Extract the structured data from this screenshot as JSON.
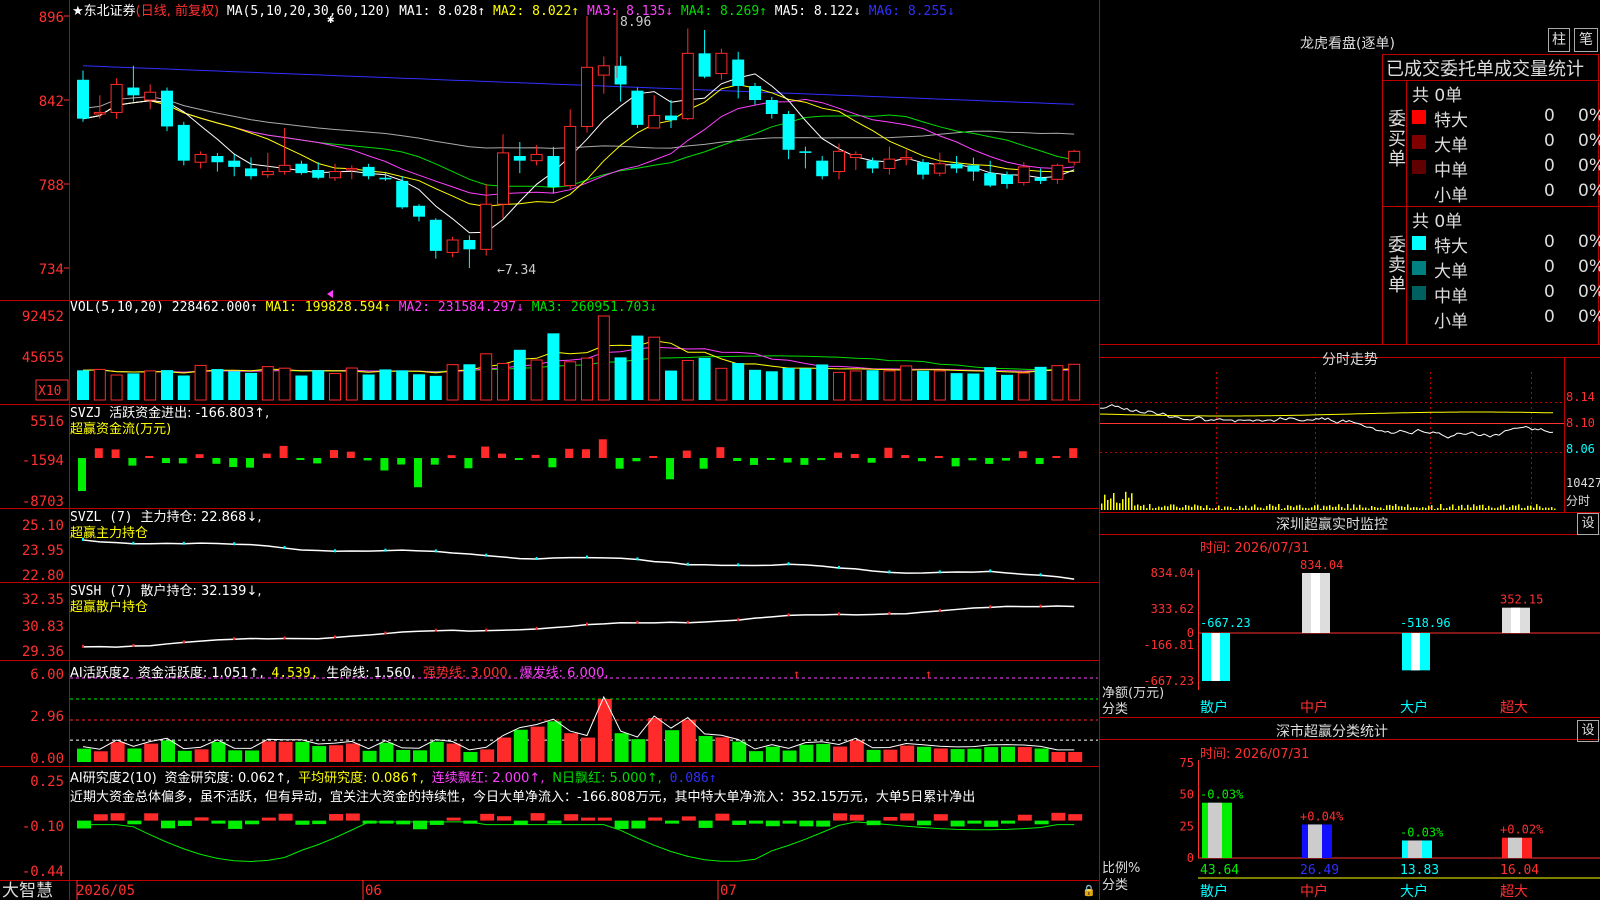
{
  "colors": {
    "up": "#ff2a2a",
    "down": "#00ffff",
    "green": "#00ee00",
    "ma1": "#ffffff",
    "ma2": "#ffff00",
    "ma3": "#ff40ff",
    "ma4": "#00dd00",
    "ma5": "#aaaaaa",
    "ma6": "#3030ff",
    "frame": "#c00000",
    "yellow": "#ffff00",
    "magenta": "#ff40ff"
  },
  "price": {
    "name": "★东北证券",
    "mode": "(日线, 前复权)",
    "ma_title": "MA(5,10,20,30,60,120)",
    "ma1": "MA1: 8.028↑",
    "ma2": "MA2: 8.022↑",
    "ma3": "MA3: 8.135↓",
    "ma4": "MA4: 8.269↑",
    "ma5": "MA5: 8.122↓",
    "ma6": "MA6: 8.255↓",
    "axis": [
      "896",
      "842",
      "788",
      "734"
    ],
    "hi_label": "8.96",
    "lo_label": "←7.34",
    "candles": [
      [
        8.55,
        8.3,
        8.61,
        8.28
      ],
      [
        8.33,
        8.34,
        8.45,
        8.3
      ],
      [
        8.34,
        8.52,
        8.56,
        8.3
      ],
      [
        8.5,
        8.45,
        8.64,
        8.41
      ],
      [
        8.42,
        8.47,
        8.52,
        8.36
      ],
      [
        8.48,
        8.25,
        8.5,
        8.22
      ],
      [
        8.26,
        8.03,
        8.28,
        8.0
      ],
      [
        8.02,
        8.07,
        8.09,
        7.98
      ],
      [
        8.06,
        8.02,
        8.08,
        7.96
      ],
      [
        8.03,
        7.99,
        8.07,
        7.93
      ],
      [
        7.98,
        7.93,
        8.05,
        7.91
      ],
      [
        7.94,
        7.96,
        8.08,
        7.92
      ],
      [
        7.96,
        8.0,
        8.24,
        7.94
      ],
      [
        8.01,
        7.95,
        8.03,
        7.94
      ],
      [
        7.97,
        7.92,
        8.02,
        7.91
      ],
      [
        7.92,
        7.96,
        8.01,
        7.9
      ],
      [
        7.97,
        7.98,
        8.0,
        7.91
      ],
      [
        7.99,
        7.93,
        8.01,
        7.91
      ],
      [
        7.92,
        7.91,
        7.95,
        7.9
      ],
      [
        7.9,
        7.73,
        7.93,
        7.72
      ],
      [
        7.74,
        7.67,
        7.75,
        7.64
      ],
      [
        7.65,
        7.45,
        7.66,
        7.4
      ],
      [
        7.44,
        7.52,
        7.54,
        7.41
      ],
      [
        7.52,
        7.46,
        7.55,
        7.34
      ],
      [
        7.46,
        7.75,
        7.88,
        7.42
      ],
      [
        7.75,
        8.08,
        8.2,
        7.66
      ],
      [
        8.06,
        8.03,
        8.15,
        7.95
      ],
      [
        8.03,
        8.07,
        8.13,
        8.0
      ],
      [
        8.06,
        7.86,
        8.12,
        7.82
      ],
      [
        7.87,
        8.25,
        8.36,
        7.85
      ],
      [
        8.25,
        8.63,
        8.96,
        8.21
      ],
      [
        8.58,
        8.64,
        8.7,
        8.46
      ],
      [
        8.64,
        8.52,
        8.7,
        8.41
      ],
      [
        8.48,
        8.26,
        8.5,
        8.24
      ],
      [
        8.24,
        8.32,
        8.45,
        8.25
      ],
      [
        8.32,
        8.29,
        8.42,
        8.24
      ],
      [
        8.3,
        8.72,
        8.88,
        8.29
      ],
      [
        8.72,
        8.57,
        8.87,
        8.56
      ],
      [
        8.59,
        8.72,
        8.75,
        8.55
      ],
      [
        8.68,
        8.51,
        8.73,
        8.43
      ],
      [
        8.51,
        8.42,
        8.53,
        8.39
      ],
      [
        8.42,
        8.33,
        8.44,
        8.3
      ],
      [
        8.33,
        8.1,
        8.35,
        8.04
      ],
      [
        8.09,
        8.08,
        8.12,
        7.98
      ],
      [
        8.03,
        7.93,
        8.06,
        7.91
      ],
      [
        7.96,
        8.09,
        8.14,
        7.91
      ],
      [
        8.05,
        8.07,
        8.09,
        7.97
      ],
      [
        8.03,
        7.98,
        8.05,
        7.95
      ],
      [
        7.98,
        8.04,
        8.12,
        7.94
      ],
      [
        8.04,
        8.05,
        8.1,
        8.0
      ],
      [
        8.02,
        7.94,
        8.04,
        7.91
      ],
      [
        7.95,
        8.01,
        8.08,
        7.93
      ],
      [
        8.01,
        7.98,
        8.06,
        7.95
      ],
      [
        8.0,
        7.96,
        8.05,
        7.9
      ],
      [
        7.95,
        7.87,
        8.03,
        7.86
      ],
      [
        7.94,
        7.88,
        7.96,
        7.85
      ],
      [
        7.89,
        7.99,
        8.02,
        7.87
      ],
      [
        7.92,
        7.9,
        7.98,
        7.88
      ],
      [
        7.91,
        8.0,
        8.01,
        7.88
      ],
      [
        8.02,
        8.09,
        8.1,
        8.0
      ]
    ]
  },
  "vol": {
    "title": "VOL(5,10,20)",
    "value": "228462.000↑",
    "ma1": "MA1: 199828.594↑",
    "ma2": "MA2: 231584.297↓",
    "ma3": "MA3: 260951.703↓",
    "axis": [
      "92452",
      "45655"
    ],
    "unit": "X10"
  },
  "svzj": {
    "title": "SVZJ",
    "text": "活跃资金进出: -166.803↑,",
    "sub": "超赢资金流(万元)",
    "axis": [
      "5516",
      "-1594",
      "-8703"
    ]
  },
  "svzl": {
    "title": "SVZL (7)",
    "text": "主力持仓: 22.868↓,",
    "sub": "超赢主力持仓",
    "axis": [
      "25.10",
      "23.95",
      "22.80"
    ]
  },
  "svsh": {
    "title": "SVSH (7)",
    "text": "散户持仓: 32.139↓,",
    "sub": "超赢散户持仓",
    "axis": [
      "32.35",
      "30.83",
      "29.36"
    ]
  },
  "ai_active": {
    "title": "AI活跃度2",
    "t1": "资金活跃度: 1.051↑,",
    "t2": "4.539,",
    "t3": "生命线: 1.560,",
    "t4": "强势线: 3.000,",
    "t5": "爆发线: 6.000,",
    "axis": [
      "6.00",
      "2.96",
      "0.00"
    ]
  },
  "ai_research": {
    "title": "AI研究度2(10)",
    "t1": "资金研究度: 0.062↑,",
    "t2": "平均研究度: 0.086↑,",
    "t3": "连续飘红: 2.000↑,",
    "t4": "N日飘红: 5.000↑,",
    "t5": "0.086↑",
    "comment": "近期大资金总体偏多，虽不活跃，但有异动，宜关注大资金的持续性，今日大单净流入：-166.808万元，其中特大单净流入：352.15万元，大单5日累计净出",
    "axis": [
      "0.25",
      "-0.10",
      "-0.44"
    ]
  },
  "bottom": {
    "brand": "大智慧",
    "dates": [
      "2026/05",
      "06",
      "07"
    ]
  },
  "right": {
    "lhb_title": "龙虎看盘(逐单)",
    "btn_bar": "柱",
    "btn_pen": "笔",
    "table_title": "已成交委托单成交量统计",
    "buy": {
      "label": "委买单",
      "total": "共 0单",
      "rows": [
        [
          "特大",
          "0",
          "0%"
        ],
        [
          "大单",
          "0",
          "0%"
        ],
        [
          "中单",
          "0",
          "0%"
        ],
        [
          "小单",
          "0",
          "0%"
        ]
      ]
    },
    "sell": {
      "label": "委卖单",
      "total": "共 0单",
      "rows": [
        [
          "特大",
          "0",
          "0%"
        ],
        [
          "大单",
          "0",
          "0%"
        ],
        [
          "中单",
          "0",
          "0%"
        ],
        [
          "小单",
          "0",
          "0%"
        ]
      ]
    },
    "intraday_title": "分时走势",
    "intraday_axis": [
      "8.14",
      "8.10",
      "8.06"
    ],
    "intraday_vol_axis": "10427",
    "intraday_vol_unit": "分时",
    "monitor_title": "深圳超赢实时监控",
    "monitor_btn": "设",
    "monitor_time": "时间: 2026/07/31",
    "monitor_axis": [
      "834.04",
      "333.62",
      "0",
      "-166.81",
      "-667.23"
    ],
    "monitor_ylabel": "净额(万元)",
    "monitor_xlabel": "分类",
    "monitor_bars": [
      {
        "name": "散户",
        "value": -667.23,
        "label": "-667.23"
      },
      {
        "name": "中户",
        "value": 834.04,
        "label": "834.04"
      },
      {
        "name": "大户",
        "value": -518.96,
        "label": "-518.96"
      },
      {
        "name": "超大",
        "value": 352.15,
        "label": "352.15"
      }
    ],
    "stats_title": "深市超赢分类统计",
    "stats_btn": "设",
    "stats_time": "时间: 2026/07/31",
    "stats_axis": [
      "75",
      "50",
      "25",
      "0"
    ],
    "stats_ylabel": "比例%",
    "stats_xlabel": "分类",
    "stats_bars": [
      {
        "name": "散户",
        "value": 43.64,
        "change": "-0.03%"
      },
      {
        "name": "中户",
        "value": 26.49,
        "change": "+0.04%"
      },
      {
        "name": "大户",
        "value": 13.83,
        "change": "-0.03%"
      },
      {
        "name": "超大",
        "value": 16.04,
        "change": "+0.02%"
      }
    ]
  }
}
